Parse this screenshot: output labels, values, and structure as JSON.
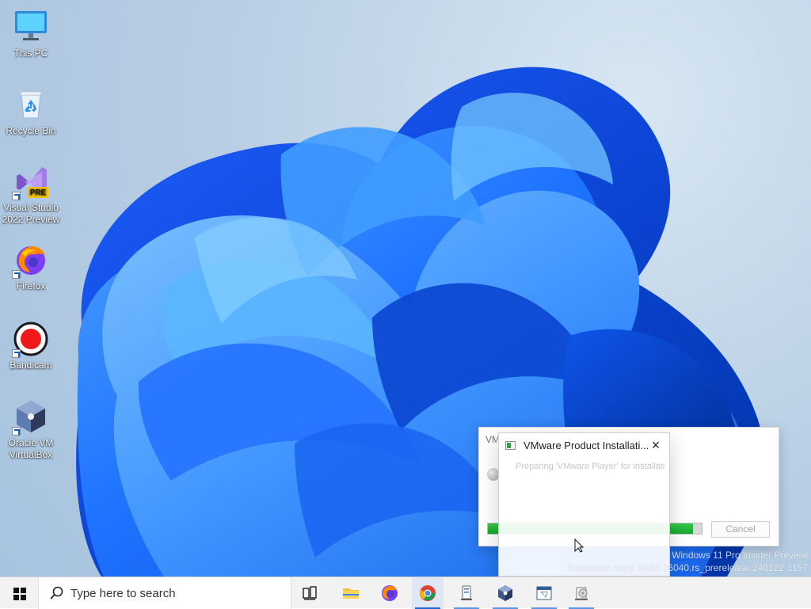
{
  "desktop": {
    "icons": [
      {
        "label": "This PC"
      },
      {
        "label": "Recycle Bin"
      },
      {
        "label_line1": "Visual Studio",
        "label_line2": "2022 Preview",
        "badge": "PRE"
      },
      {
        "label": "Firefox"
      },
      {
        "label": "Bandicam"
      },
      {
        "label_line1": "Oracle VM",
        "label_line2": "VirtualBox"
      }
    ]
  },
  "dialogs": {
    "background": {
      "title_fragment": "VM"
    },
    "foreground": {
      "title": "VMware Product Installati...",
      "status": "Preparing 'VMware Player' for installation...",
      "progress": 0.96,
      "cancel_label": "Cancel"
    }
  },
  "watermark": {
    "line1": "Windows 11 Pro Insider Preview",
    "line2": "Evaluation copy. Build 26040.rs_prerelease.240122-1157"
  },
  "taskbar": {
    "search_placeholder": "Type here to search",
    "apps": [
      {
        "name": "task-view",
        "icon": "task-view-icon"
      },
      {
        "name": "file-explorer",
        "icon": "folder-icon"
      },
      {
        "name": "firefox",
        "icon": "firefox-icon"
      },
      {
        "name": "chrome",
        "icon": "chrome-icon"
      },
      {
        "name": "installer",
        "icon": "installer-icon"
      },
      {
        "name": "virtualbox",
        "icon": "virtualbox-icon"
      },
      {
        "name": "cpu-z",
        "icon": "cpuz-icon"
      },
      {
        "name": "vmware-installer",
        "icon": "disk-installer-icon"
      }
    ]
  }
}
